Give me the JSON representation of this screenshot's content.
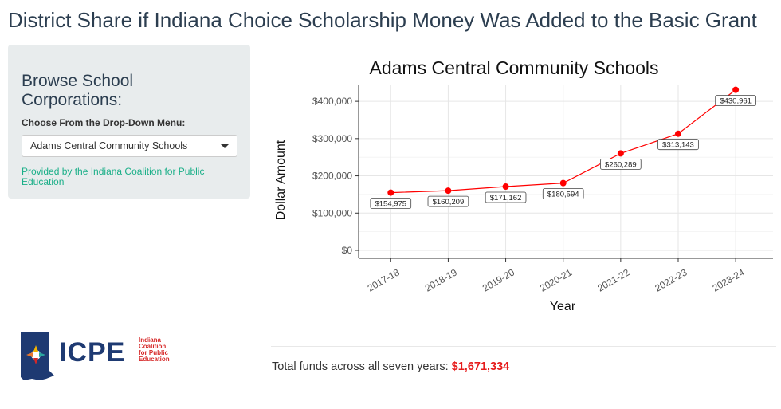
{
  "page": {
    "title": "District Share if Indiana Choice Scholarship Money Was Added to the Basic Grant"
  },
  "sidebar": {
    "heading": "Browse School Corporations:",
    "dropdown_label": "Choose From the Drop-Down Menu:",
    "selected_value": "Adams Central Community Schools",
    "credit": "Provided by the Indiana Coalition for Public Education"
  },
  "logo": {
    "word": "ICPE",
    "sub_lines": [
      "Indiana",
      "Coalition",
      "for Public",
      "Education"
    ]
  },
  "colors": {
    "series": "#ff0000",
    "accent_green": "#1aaf88",
    "total": "#e61b1b"
  },
  "chart_data": {
    "type": "line",
    "title": "Adams Central Community Schools",
    "xlabel": "Year",
    "ylabel": "Dollar Amount",
    "categories": [
      "2017-18",
      "2018-19",
      "2019-20",
      "2020-21",
      "2021-22",
      "2022-23",
      "2023-24"
    ],
    "values": [
      154975,
      160209,
      171162,
      180594,
      260289,
      313143,
      430961
    ],
    "value_labels": [
      "$154,975",
      "$160,209",
      "$171,162",
      "$180,594",
      "$260,289",
      "$313,143",
      "$430,961"
    ],
    "y_ticks": [
      0,
      100000,
      200000,
      300000,
      400000
    ],
    "y_tick_labels": [
      "$0",
      "$100,000",
      "$200,000",
      "$300,000",
      "$400,000"
    ],
    "ylim": [
      0,
      430961
    ],
    "grid": true,
    "legend": "none"
  },
  "total": {
    "label": "Total funds across all seven years:",
    "value": "$1,671,334"
  }
}
